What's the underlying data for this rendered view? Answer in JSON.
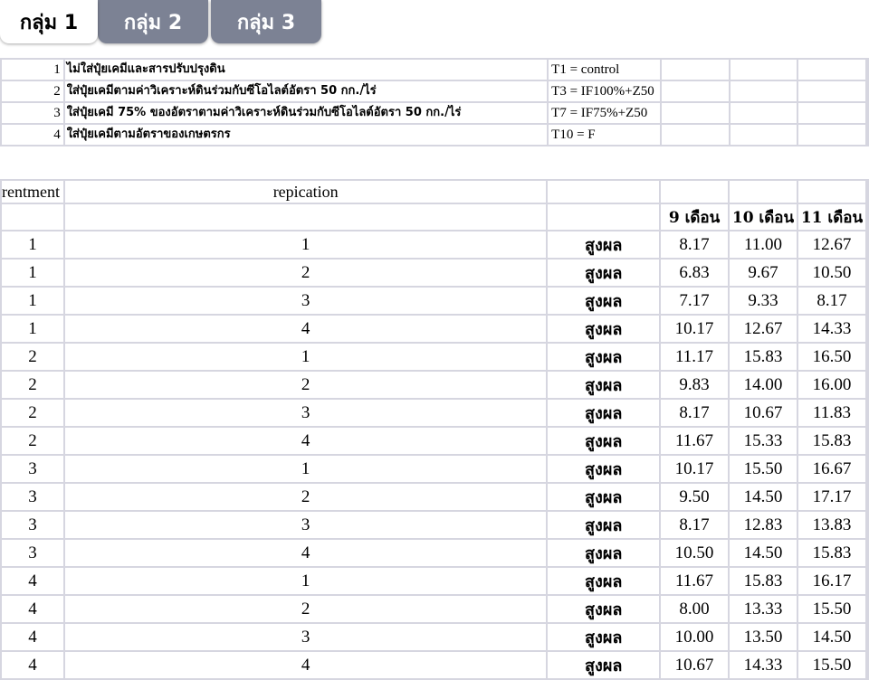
{
  "tabs": [
    {
      "label": "กลุ่ม 1",
      "active": true
    },
    {
      "label": "กลุ่ม 2",
      "active": false
    },
    {
      "label": "กลุ่ม 3",
      "active": false
    }
  ],
  "treatments": [
    {
      "num": "1",
      "desc": "ไม่ใส่ปุ๋ยเคมีและสารปรับปรุงดิน",
      "code": "T1 = control"
    },
    {
      "num": "2",
      "desc": "ใส่ปุ๋ยเคมีตามค่าวิเคราะห์ดินร่วมกับซีโอไลต์อัตรา 50 กก./ไร่",
      "code": "T3 = IF100%+Z50"
    },
    {
      "num": "3",
      "desc": "ใส่ปุ๋ยเคมี 75% ของอัตราตามค่าวิเคราะห์ดินร่วมกับซีโอไลต์อัตรา 50 กก./ไร่",
      "code": "T7 = IF75%+Z50"
    },
    {
      "num": "4",
      "desc": "ใส่ปุ๋ยเคมีตามอัตราของเกษตรกร",
      "code": "T10 = F"
    }
  ],
  "table": {
    "col_treatment": "rentment",
    "col_replication": "repication",
    "months": [
      "9 เดือน",
      "10 เดือน",
      "11 เดือน"
    ],
    "rows": [
      {
        "t": "1",
        "r": "1",
        "label": "สูงผล",
        "v": [
          "8.17",
          "11.00",
          "12.67"
        ]
      },
      {
        "t": "1",
        "r": "2",
        "label": "สูงผล",
        "v": [
          "6.83",
          "9.67",
          "10.50"
        ]
      },
      {
        "t": "1",
        "r": "3",
        "label": "สูงผล",
        "v": [
          "7.17",
          "9.33",
          "8.17"
        ]
      },
      {
        "t": "1",
        "r": "4",
        "label": "สูงผล",
        "v": [
          "10.17",
          "12.67",
          "14.33"
        ]
      },
      {
        "t": "2",
        "r": "1",
        "label": "สูงผล",
        "v": [
          "11.17",
          "15.83",
          "16.50"
        ]
      },
      {
        "t": "2",
        "r": "2",
        "label": "สูงผล",
        "v": [
          "9.83",
          "14.00",
          "16.00"
        ]
      },
      {
        "t": "2",
        "r": "3",
        "label": "สูงผล",
        "v": [
          "8.17",
          "10.67",
          "11.83"
        ]
      },
      {
        "t": "2",
        "r": "4",
        "label": "สูงผล",
        "v": [
          "11.67",
          "15.33",
          "15.83"
        ]
      },
      {
        "t": "3",
        "r": "1",
        "label": "สูงผล",
        "v": [
          "10.17",
          "15.50",
          "16.67"
        ]
      },
      {
        "t": "3",
        "r": "2",
        "label": "สูงผล",
        "v": [
          "9.50",
          "14.50",
          "17.17"
        ]
      },
      {
        "t": "3",
        "r": "3",
        "label": "สูงผล",
        "v": [
          "8.17",
          "12.83",
          "13.83"
        ]
      },
      {
        "t": "3",
        "r": "4",
        "label": "สูงผล",
        "v": [
          "10.50",
          "14.50",
          "15.83"
        ]
      },
      {
        "t": "4",
        "r": "1",
        "label": "สูงผล",
        "v": [
          "11.67",
          "15.83",
          "16.17"
        ]
      },
      {
        "t": "4",
        "r": "2",
        "label": "สูงผล",
        "v": [
          "8.00",
          "13.33",
          "15.50"
        ]
      },
      {
        "t": "4",
        "r": "3",
        "label": "สูงผล",
        "v": [
          "10.00",
          "13.50",
          "14.50"
        ]
      },
      {
        "t": "4",
        "r": "4",
        "label": "สูงผล",
        "v": [
          "10.67",
          "14.33",
          "15.50"
        ]
      }
    ]
  }
}
